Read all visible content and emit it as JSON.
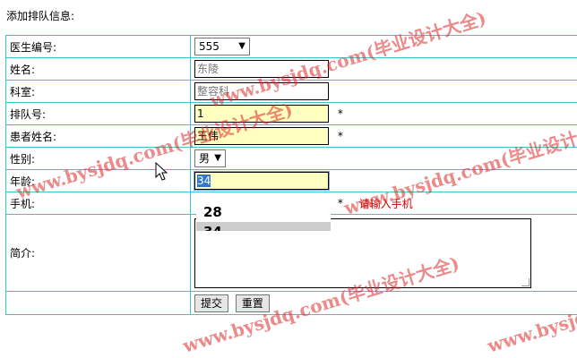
{
  "page": {
    "heading": "添加排队信息:"
  },
  "form": {
    "doctor_id": {
      "label": "医生编号:",
      "value": "555"
    },
    "name": {
      "label": "姓名:",
      "value": "东陵"
    },
    "department": {
      "label": "科室:",
      "value": "整容科"
    },
    "queue_no": {
      "label": "排队号:",
      "value": "1",
      "required_mark": "*"
    },
    "patient_name": {
      "label": "患者姓名:",
      "value": "王伟",
      "required_mark": "*"
    },
    "gender": {
      "label": "性别:",
      "value": "男"
    },
    "age": {
      "label": "年龄:",
      "value": "34"
    },
    "phone": {
      "label": "手机:",
      "value": "",
      "required_mark": "*",
      "hint": "请输入手机"
    },
    "intro": {
      "label": "简介:",
      "value": ""
    },
    "submit_label": "提交",
    "reset_label": "重置"
  },
  "autocomplete": {
    "items": [
      "28",
      "34"
    ],
    "active_index": 1
  },
  "watermark": {
    "text": "www.bysjdq.com(毕业设计大全)"
  },
  "colors": {
    "table_border": "#3cc6cc",
    "required_bg": "#ffffc0",
    "hint": "#cc0000",
    "watermark": "#dc2828"
  }
}
